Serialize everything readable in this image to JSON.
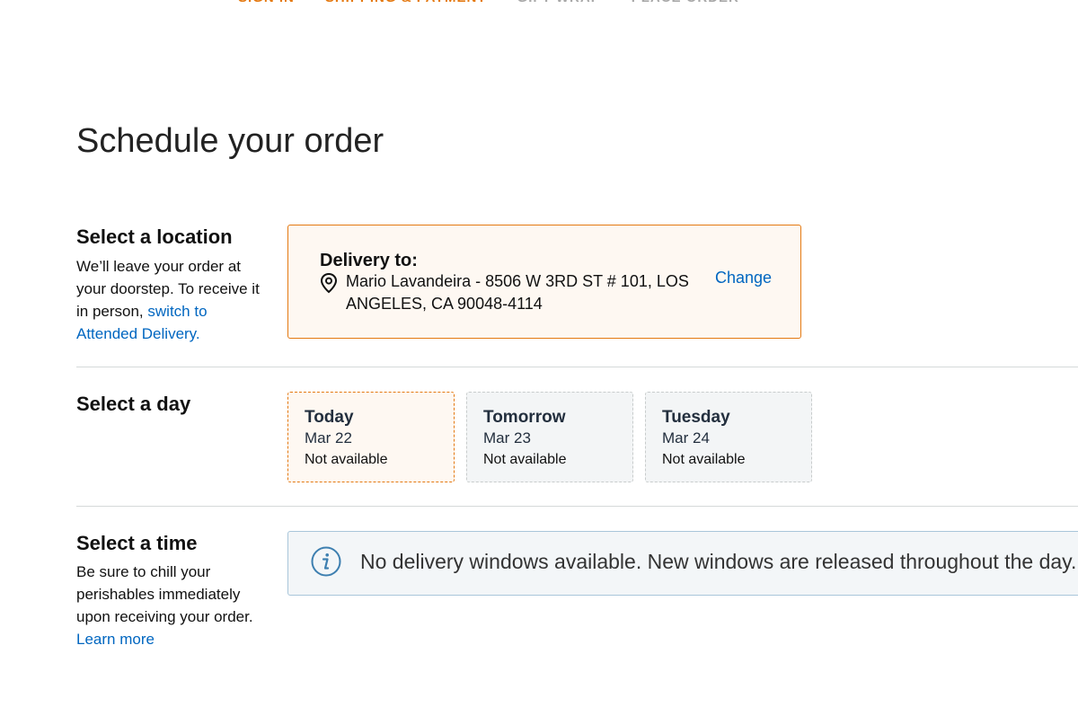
{
  "steps": [
    {
      "label": "SIGN IN",
      "state": "done"
    },
    {
      "label": "SHIPPING & PAYMENT",
      "state": "done"
    },
    {
      "label": "GIFT-WRAP",
      "state": "todo"
    },
    {
      "label": "PLACE ORDER",
      "state": "todo"
    }
  ],
  "page_title": "Schedule your order",
  "location": {
    "heading": "Select a location",
    "desc_prefix": "We’ll leave your order at your doorstep. To receive it in person, ",
    "desc_link": "switch to Attended Delivery.",
    "delivery_label": "Delivery to:",
    "address": "Mario Lavandeira - 8506 W 3RD ST # 101, LOS ANGELES, CA 90048-4114",
    "change_label": "Change",
    "icon": "location-pin-icon"
  },
  "day": {
    "heading": "Select a day",
    "options": [
      {
        "name": "Today",
        "date": "Mar 22",
        "status": "Not available",
        "selected": true
      },
      {
        "name": "Tomorrow",
        "date": "Mar 23",
        "status": "Not available",
        "selected": false
      },
      {
        "name": "Tuesday",
        "date": "Mar 24",
        "status": "Not available",
        "selected": false
      }
    ]
  },
  "time": {
    "heading": "Select a time",
    "desc": "Be sure to chill your perishables immediately upon receiving your order.",
    "learn_more": "Learn more",
    "info_message": "No delivery windows available. New windows are released throughout the day.",
    "icon": "info-icon"
  },
  "colors": {
    "accent_orange": "#e47911",
    "link_blue": "#0066c0",
    "selected_bg": "#fef8f2",
    "info_border": "#a9c6da"
  }
}
